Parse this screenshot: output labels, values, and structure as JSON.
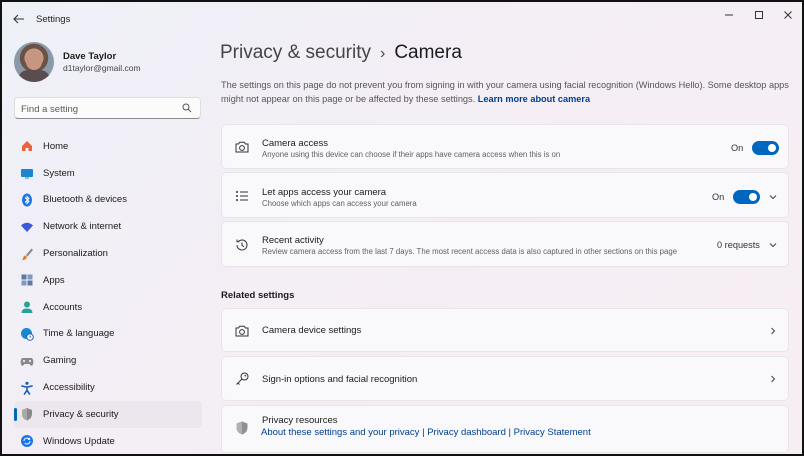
{
  "window": {
    "title": "Settings"
  },
  "profile": {
    "name": "Dave Taylor",
    "email": "d1taylor@gmail.com"
  },
  "search": {
    "placeholder": "Find a setting"
  },
  "nav": [
    {
      "label": "Home",
      "icon": "home-icon",
      "color": "#e8643c"
    },
    {
      "label": "System",
      "icon": "monitor-icon",
      "color": "#1a86d0"
    },
    {
      "label": "Bluetooth & devices",
      "icon": "bluetooth-icon",
      "color": "#1a73e8"
    },
    {
      "label": "Network & internet",
      "icon": "wifi-icon",
      "color": "#3b5bdb"
    },
    {
      "label": "Personalization",
      "icon": "brush-icon",
      "color": "#d9822b"
    },
    {
      "label": "Apps",
      "icon": "apps-icon",
      "color": "#5b7aa8"
    },
    {
      "label": "Accounts",
      "icon": "person-icon",
      "color": "#2aa198"
    },
    {
      "label": "Time & language",
      "icon": "globe-clock-icon",
      "color": "#1a86d0"
    },
    {
      "label": "Gaming",
      "icon": "controller-icon",
      "color": "#7a7a7a"
    },
    {
      "label": "Accessibility",
      "icon": "accessibility-icon",
      "color": "#1a5fb4"
    },
    {
      "label": "Privacy & security",
      "icon": "shield-icon",
      "color": "#7a7a7a",
      "active": true
    },
    {
      "label": "Windows Update",
      "icon": "update-icon",
      "color": "#1a73e8"
    }
  ],
  "header": {
    "parent": "Privacy & security",
    "separator": "›",
    "current": "Camera"
  },
  "description": {
    "text": "The settings on this page do not prevent you from signing in with your camera using facial recognition (Windows Hello). Some desktop apps might not appear on this page or be affected by these settings.",
    "link": "Learn more about camera"
  },
  "cards": {
    "camera_access": {
      "title": "Camera access",
      "subtitle": "Anyone using this device can choose if their apps have camera access when this is on",
      "state": "On"
    },
    "apps_access": {
      "title": "Let apps access your camera",
      "subtitle": "Choose which apps can access your camera",
      "state": "On"
    },
    "recent": {
      "title": "Recent activity",
      "subtitle": "Review camera access from the last 7 days. The most recent access data is also captured in other sections on this page",
      "state": "0 requests"
    }
  },
  "related": {
    "heading": "Related settings",
    "camera_device": "Camera device settings",
    "signin": "Sign-in options and facial recognition",
    "privacy_resources": {
      "title": "Privacy resources",
      "link1": "About these settings and your privacy",
      "link2": "Privacy dashboard",
      "link3": "Privacy Statement",
      "divider": "|"
    }
  },
  "colors": {
    "accent": "#0067c0",
    "link": "#003e92"
  }
}
